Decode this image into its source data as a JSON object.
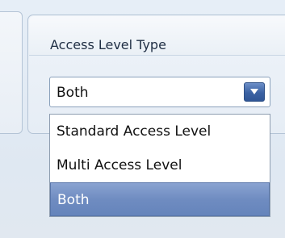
{
  "group": {
    "title": "Access Level Type"
  },
  "combo": {
    "value": "Both"
  },
  "dropdown": {
    "options": [
      {
        "label": "Standard Access Level"
      },
      {
        "label": "Multi Access Level"
      },
      {
        "label": "Both",
        "selected": true
      }
    ]
  },
  "colors": {
    "selection": "#6f8cc1",
    "accent": "#3b62a3"
  },
  "icons": {
    "dropdown_button": "chevron-down-icon"
  }
}
